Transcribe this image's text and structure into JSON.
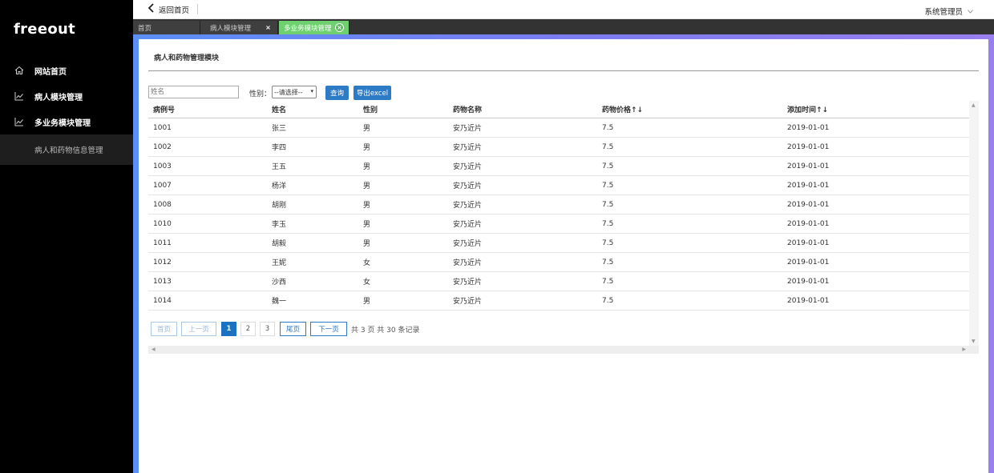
{
  "sidebar": {
    "logo": "freeout",
    "items": [
      {
        "label": "网站首页"
      },
      {
        "label": "病人模块管理"
      },
      {
        "label": "多业务模块管理"
      }
    ],
    "sub_item": "病人和药物信息管理"
  },
  "topbar": {
    "back_label": "返回首页",
    "user_label": "系统管理员"
  },
  "tabs": [
    {
      "label": "首页"
    },
    {
      "label": "病人模块管理",
      "close": "×"
    },
    {
      "label": "多业务模块管理",
      "close": "×"
    }
  ],
  "panel": {
    "title": "病人和药物管理模块"
  },
  "toolbar": {
    "name_placeholder": "姓名",
    "gender_label": "性别：",
    "gender_select": "--请选择--",
    "query_button": "查询",
    "export_button": "导出excel"
  },
  "table": {
    "headers": [
      "病例号",
      "姓名",
      "性别",
      "药物名称",
      "药物价格↑↓",
      "添加时间↑↓"
    ],
    "rows": [
      [
        "1001",
        "张三",
        "男",
        "安乃近片",
        "7.5",
        "2019-01-01"
      ],
      [
        "1002",
        "李四",
        "男",
        "安乃近片",
        "7.5",
        "2019-01-01"
      ],
      [
        "1003",
        "王五",
        "男",
        "安乃近片",
        "7.5",
        "2019-01-01"
      ],
      [
        "1007",
        "杨洋",
        "男",
        "安乃近片",
        "7.5",
        "2019-01-01"
      ],
      [
        "1008",
        "胡刚",
        "男",
        "安乃近片",
        "7.5",
        "2019-01-01"
      ],
      [
        "1010",
        "李玉",
        "男",
        "安乃近片",
        "7.5",
        "2019-01-01"
      ],
      [
        "1011",
        "胡毅",
        "男",
        "安乃近片",
        "7.5",
        "2019-01-01"
      ],
      [
        "1012",
        "王妮",
        "女",
        "安乃近片",
        "7.5",
        "2019-01-01"
      ],
      [
        "1013",
        "沙西",
        "女",
        "安乃近片",
        "7.5",
        "2019-01-01"
      ],
      [
        "1014",
        "魏一",
        "男",
        "安乃近片",
        "7.5",
        "2019-01-01"
      ]
    ]
  },
  "pagination": {
    "first": "首页",
    "prev": "上一页",
    "pages": [
      "1",
      "2",
      "3"
    ],
    "current": "1",
    "last": "尾页",
    "next": "下一页",
    "info": "共 3 页 共 30 条记录"
  },
  "colors": {
    "sidebar_bg": "#000000",
    "active_tab": "#6ed06e",
    "primary_button": "#2d7bc6",
    "frame_gradient_start": "#5b8ff7",
    "frame_gradient_end": "#9a7ff0"
  }
}
